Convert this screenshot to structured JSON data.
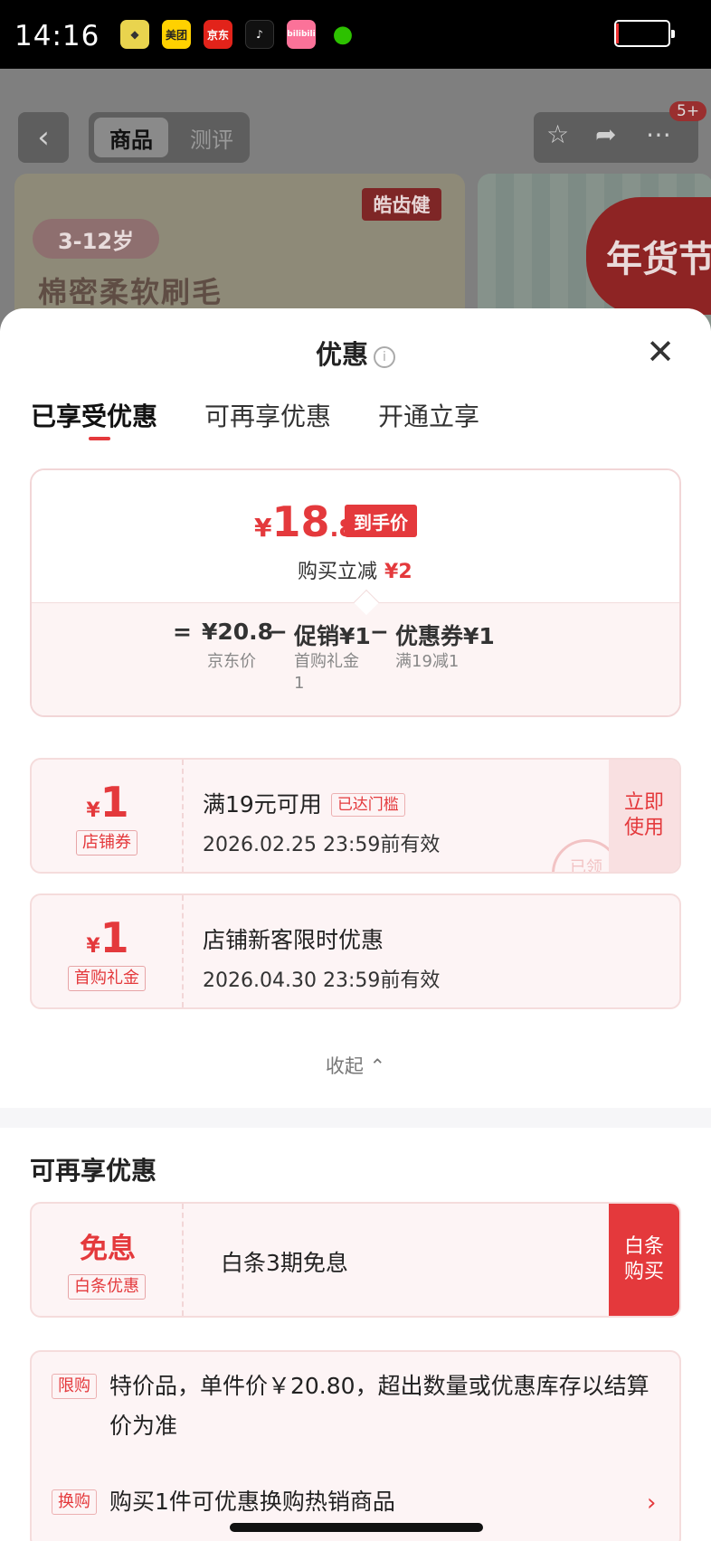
{
  "status_bar": {
    "time": "14:16",
    "apps": [
      "cp-app",
      "美团",
      "京东",
      "抖音",
      "bilibili",
      "微信"
    ]
  },
  "background": {
    "tab_product": "商品",
    "tab_review": "测评",
    "badge": "5+",
    "brand": "皓齿健",
    "age": "3-12岁",
    "slogan": "棉密柔软刷毛",
    "festival": "年货节"
  },
  "sheet": {
    "title": "优惠",
    "tabs": [
      "已享受优惠",
      "可再享优惠",
      "开通立享"
    ],
    "summary": {
      "currency": "¥",
      "price_int": "18",
      "price_dec": ".8",
      "price_tag": "到手价",
      "instant_label": "购买立减",
      "instant_amount": "¥2",
      "eq": "=",
      "jd_price": "¥20.8",
      "minus1": "−",
      "promo": "促销¥1",
      "minus2": "−",
      "coupon": "优惠券¥1",
      "jd_price_label": "京东价",
      "promo_label": "首购礼金",
      "promo_label2": "1",
      "coupon_label": "满19减1"
    },
    "coupons": [
      {
        "currency": "¥",
        "amount": "1",
        "type": "店铺券",
        "title": "满19元可用",
        "reach": "已达门槛",
        "date": "2026.02.25 23:59前有效",
        "action_l1": "立即",
        "action_l2": "使用",
        "stamp": "已领"
      },
      {
        "currency": "¥",
        "amount": "1",
        "type": "首购礼金",
        "title": "店铺新客限时优惠",
        "date": "2026.04.30 23:59前有效"
      }
    ],
    "collapse": "收起",
    "section2_title": "可再享优惠",
    "baitiao": {
      "big": "免息",
      "type": "白条优惠",
      "title": "白条3期免息",
      "action_l1": "白条",
      "action_l2": "购买"
    },
    "rules": [
      {
        "tag": "限购",
        "text": "特价品，单件价￥20.80，超出数量或优惠库存以结算价为准"
      },
      {
        "tag": "换购",
        "text": "购买1件可优惠换购热销商品"
      }
    ]
  },
  "colors": {
    "accent": "#e4393c",
    "card_bg": "#fdf4f5"
  }
}
